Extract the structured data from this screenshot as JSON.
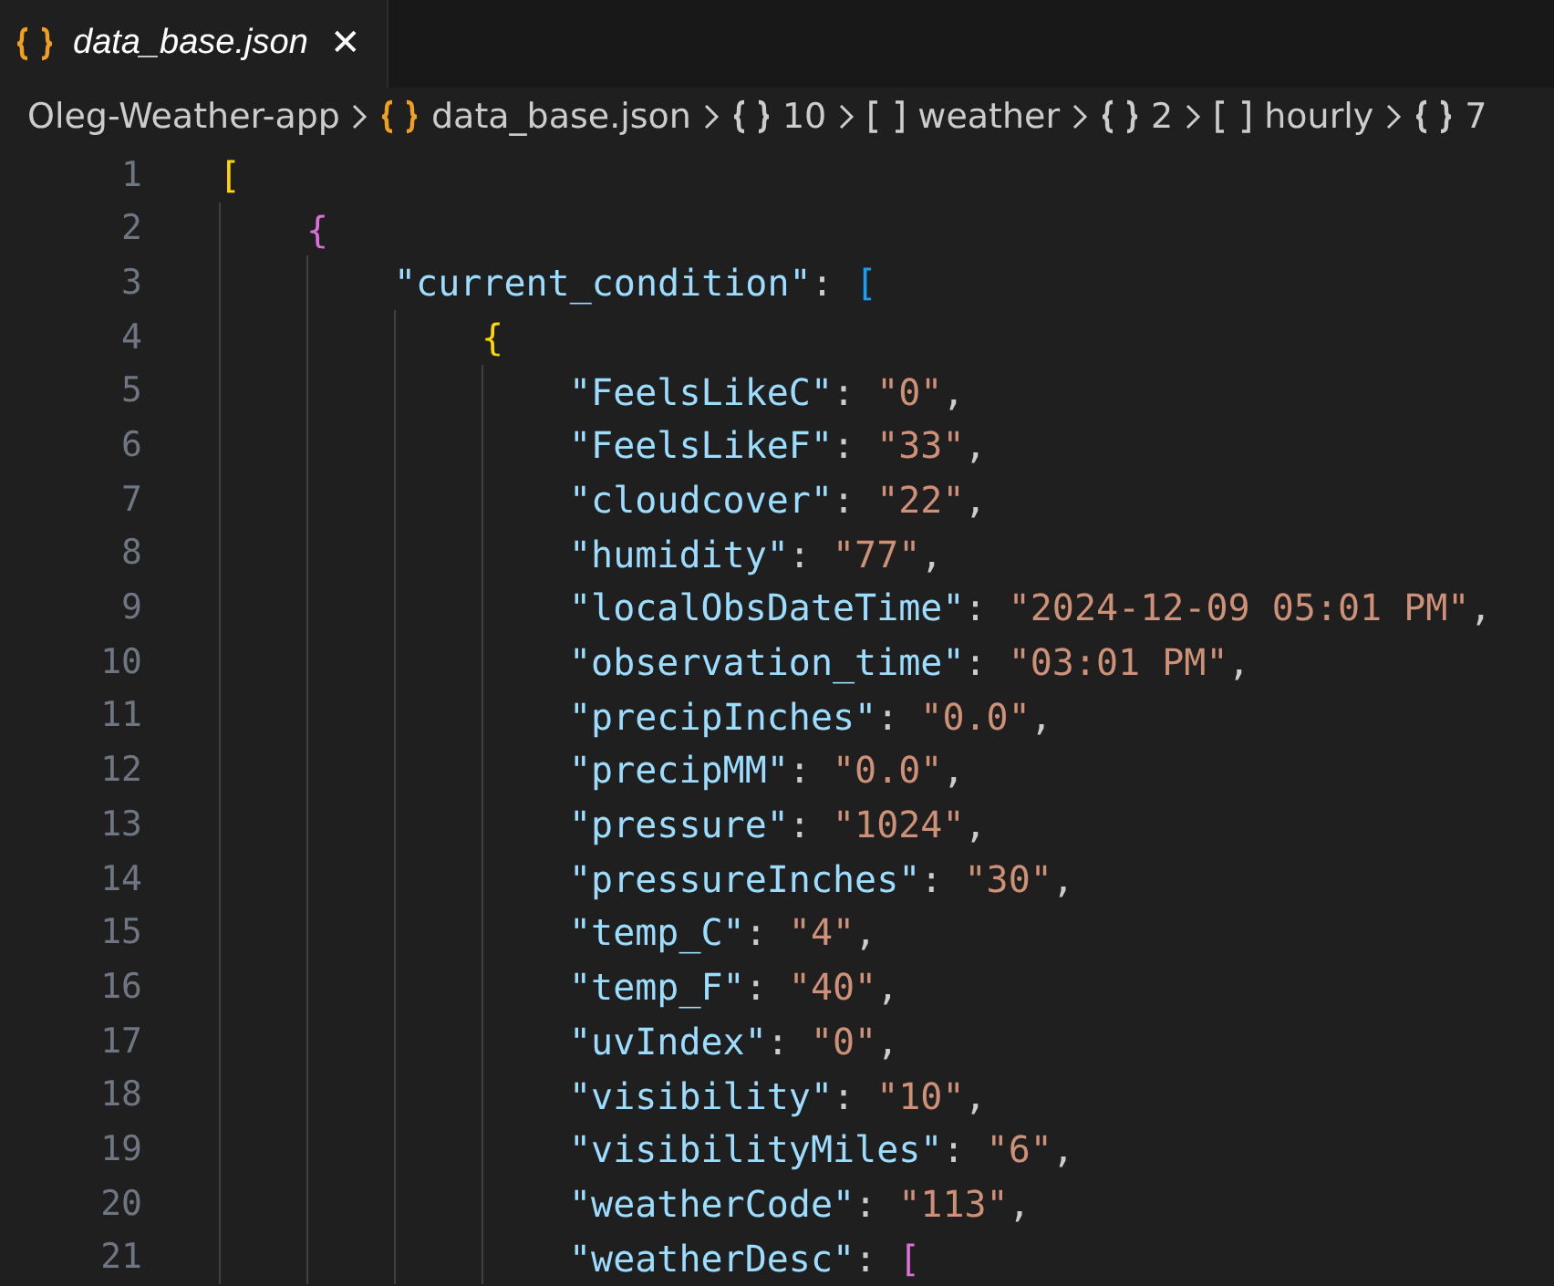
{
  "tab": {
    "title": "data_base.json",
    "close": "✕",
    "selected": true
  },
  "breadcrumbs": [
    {
      "kind": "folder",
      "label": "Oleg-Weather-app"
    },
    {
      "kind": "file",
      "label": "data_base.json"
    },
    {
      "kind": "object",
      "label": "10"
    },
    {
      "kind": "array",
      "label": "weather"
    },
    {
      "kind": "object",
      "label": "2"
    },
    {
      "kind": "array",
      "label": "hourly"
    },
    {
      "kind": "object",
      "label": "7"
    }
  ],
  "editor": {
    "lines": [
      {
        "number": "1",
        "tokens": [
          {
            "kind": "bracket",
            "text": "["
          }
        ],
        "children": [
          {
            "number": "2",
            "tokens": [
              {
                "kind": "bracket",
                "text": "{"
              }
            ],
            "children": [
              {
                "number": "3",
                "tokens": [
                  {
                    "kind": "key",
                    "text": "\"current_condition\""
                  },
                  {
                    "kind": "punct",
                    "text": ": "
                  },
                  {
                    "kind": "bracket",
                    "text": "["
                  }
                ],
                "children": [
                  {
                    "number": "4",
                    "tokens": [
                      {
                        "kind": "bracket",
                        "text": "{"
                      }
                    ],
                    "children": [
                      {
                        "number": "5",
                        "tokens": [
                          {
                            "kind": "key",
                            "text": "\"FeelsLikeC\""
                          },
                          {
                            "kind": "punct",
                            "text": ": "
                          },
                          {
                            "kind": "string",
                            "text": "\"0\""
                          },
                          {
                            "kind": "punct",
                            "text": ","
                          }
                        ]
                      },
                      {
                        "number": "6",
                        "tokens": [
                          {
                            "kind": "key",
                            "text": "\"FeelsLikeF\""
                          },
                          {
                            "kind": "punct",
                            "text": ": "
                          },
                          {
                            "kind": "string",
                            "text": "\"33\""
                          },
                          {
                            "kind": "punct",
                            "text": ","
                          }
                        ]
                      },
                      {
                        "number": "7",
                        "tokens": [
                          {
                            "kind": "key",
                            "text": "\"cloudcover\""
                          },
                          {
                            "kind": "punct",
                            "text": ": "
                          },
                          {
                            "kind": "string",
                            "text": "\"22\""
                          },
                          {
                            "kind": "punct",
                            "text": ","
                          }
                        ]
                      },
                      {
                        "number": "8",
                        "tokens": [
                          {
                            "kind": "key",
                            "text": "\"humidity\""
                          },
                          {
                            "kind": "punct",
                            "text": ": "
                          },
                          {
                            "kind": "string",
                            "text": "\"77\""
                          },
                          {
                            "kind": "punct",
                            "text": ","
                          }
                        ]
                      },
                      {
                        "number": "9",
                        "tokens": [
                          {
                            "kind": "key",
                            "text": "\"localObsDateTime\""
                          },
                          {
                            "kind": "punct",
                            "text": ": "
                          },
                          {
                            "kind": "string",
                            "text": "\"2024-12-09 05:01 PM\""
                          },
                          {
                            "kind": "punct",
                            "text": ","
                          }
                        ]
                      },
                      {
                        "number": "10",
                        "tokens": [
                          {
                            "kind": "key",
                            "text": "\"observation_time\""
                          },
                          {
                            "kind": "punct",
                            "text": ": "
                          },
                          {
                            "kind": "string",
                            "text": "\"03:01 PM\""
                          },
                          {
                            "kind": "punct",
                            "text": ","
                          }
                        ]
                      },
                      {
                        "number": "11",
                        "tokens": [
                          {
                            "kind": "key",
                            "text": "\"precipInches\""
                          },
                          {
                            "kind": "punct",
                            "text": ": "
                          },
                          {
                            "kind": "string",
                            "text": "\"0.0\""
                          },
                          {
                            "kind": "punct",
                            "text": ","
                          }
                        ]
                      },
                      {
                        "number": "12",
                        "tokens": [
                          {
                            "kind": "key",
                            "text": "\"precipMM\""
                          },
                          {
                            "kind": "punct",
                            "text": ": "
                          },
                          {
                            "kind": "string",
                            "text": "\"0.0\""
                          },
                          {
                            "kind": "punct",
                            "text": ","
                          }
                        ]
                      },
                      {
                        "number": "13",
                        "tokens": [
                          {
                            "kind": "key",
                            "text": "\"pressure\""
                          },
                          {
                            "kind": "punct",
                            "text": ": "
                          },
                          {
                            "kind": "string",
                            "text": "\"1024\""
                          },
                          {
                            "kind": "punct",
                            "text": ","
                          }
                        ]
                      },
                      {
                        "number": "14",
                        "tokens": [
                          {
                            "kind": "key",
                            "text": "\"pressureInches\""
                          },
                          {
                            "kind": "punct",
                            "text": ": "
                          },
                          {
                            "kind": "string",
                            "text": "\"30\""
                          },
                          {
                            "kind": "punct",
                            "text": ","
                          }
                        ]
                      },
                      {
                        "number": "15",
                        "tokens": [
                          {
                            "kind": "key",
                            "text": "\"temp_C\""
                          },
                          {
                            "kind": "punct",
                            "text": ": "
                          },
                          {
                            "kind": "string",
                            "text": "\"4\""
                          },
                          {
                            "kind": "punct",
                            "text": ","
                          }
                        ]
                      },
                      {
                        "number": "16",
                        "tokens": [
                          {
                            "kind": "key",
                            "text": "\"temp_F\""
                          },
                          {
                            "kind": "punct",
                            "text": ": "
                          },
                          {
                            "kind": "string",
                            "text": "\"40\""
                          },
                          {
                            "kind": "punct",
                            "text": ","
                          }
                        ]
                      },
                      {
                        "number": "17",
                        "tokens": [
                          {
                            "kind": "key",
                            "text": "\"uvIndex\""
                          },
                          {
                            "kind": "punct",
                            "text": ": "
                          },
                          {
                            "kind": "string",
                            "text": "\"0\""
                          },
                          {
                            "kind": "punct",
                            "text": ","
                          }
                        ]
                      },
                      {
                        "number": "18",
                        "tokens": [
                          {
                            "kind": "key",
                            "text": "\"visibility\""
                          },
                          {
                            "kind": "punct",
                            "text": ": "
                          },
                          {
                            "kind": "string",
                            "text": "\"10\""
                          },
                          {
                            "kind": "punct",
                            "text": ","
                          }
                        ]
                      },
                      {
                        "number": "19",
                        "tokens": [
                          {
                            "kind": "key",
                            "text": "\"visibilityMiles\""
                          },
                          {
                            "kind": "punct",
                            "text": ": "
                          },
                          {
                            "kind": "string",
                            "text": "\"6\""
                          },
                          {
                            "kind": "punct",
                            "text": ","
                          }
                        ]
                      },
                      {
                        "number": "20",
                        "tokens": [
                          {
                            "kind": "key",
                            "text": "\"weatherCode\""
                          },
                          {
                            "kind": "punct",
                            "text": ": "
                          },
                          {
                            "kind": "string",
                            "text": "\"113\""
                          },
                          {
                            "kind": "punct",
                            "text": ","
                          }
                        ]
                      },
                      {
                        "number": "21",
                        "tokens": [
                          {
                            "kind": "key",
                            "text": "\"weatherDesc\""
                          },
                          {
                            "kind": "punct",
                            "text": ": "
                          },
                          {
                            "kind": "bracket",
                            "text": "["
                          }
                        ]
                      }
                    ]
                  }
                ]
              }
            ]
          }
        ]
      }
    ]
  }
}
